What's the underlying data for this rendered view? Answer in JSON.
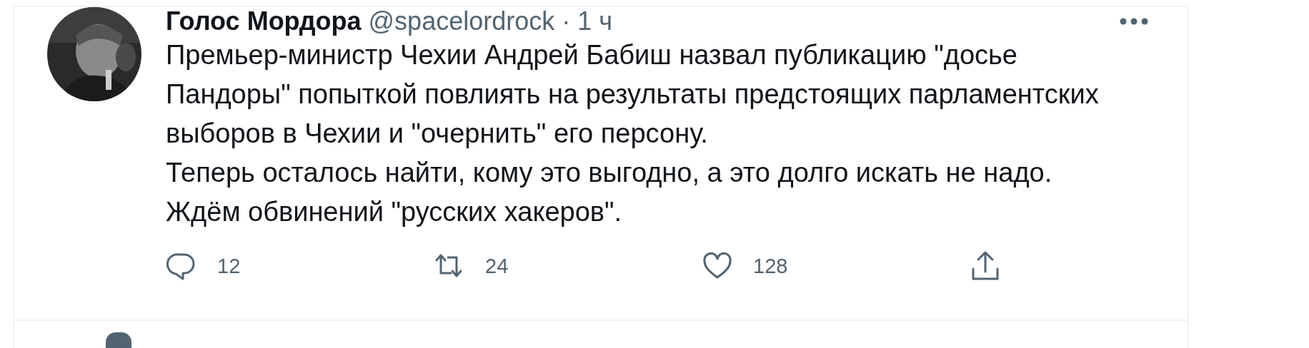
{
  "tweet": {
    "author": "Голос Мордора",
    "handle": "@spacelordrock",
    "separator": "·",
    "time": "1 ч",
    "text": [
      "Премьер-министр Чехии Андрей Бабиш назвал публикацию \"досье Пандоры\" попыткой повлиять на результаты предстоящих парламентских выборов в Чехии и \"очернить\" его персону.",
      "Теперь осталось найти, кому это выгодно, а это долго искать не надо.",
      "Ждём обвинений \"русских хакеров\"."
    ],
    "actions": [
      {
        "kind": "reply",
        "count": "12"
      },
      {
        "kind": "retweet",
        "count": "24"
      },
      {
        "kind": "like",
        "count": "128"
      },
      {
        "kind": "share"
      }
    ]
  }
}
